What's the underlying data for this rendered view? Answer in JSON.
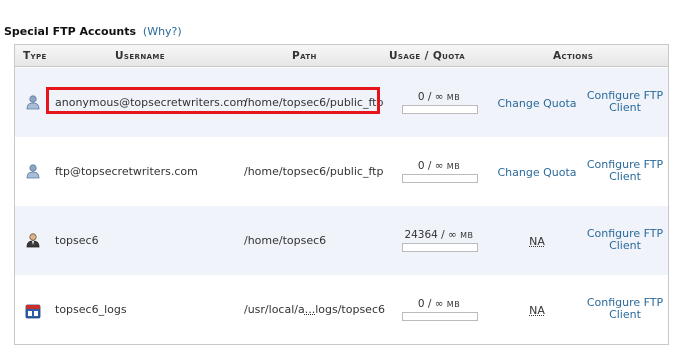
{
  "section": {
    "title": "Special FTP Accounts",
    "why": "(Why?)"
  },
  "columns": {
    "type": "Type",
    "username": "Username",
    "path": "Path",
    "quota": "Usage / Quota",
    "actions": "Actions"
  },
  "rows": [
    {
      "icon": "user-icon",
      "username": "anonymous@topsecretwriters.com",
      "path": "/home/topsec6/public_ftp",
      "usage": "0 / ∞",
      "unit": "MB",
      "usage_fraction": 0,
      "action1": "Change Quota",
      "action2_line1": "Configure FTP",
      "action2_line2": "Client",
      "highlighted": true
    },
    {
      "icon": "user-icon",
      "username": "ftp@topsecretwriters.com",
      "path": "/home/topsec6/public_ftp",
      "usage": "0 / ∞",
      "unit": "MB",
      "usage_fraction": 0,
      "action1": "Change Quota",
      "action2_line1": "Configure FTP",
      "action2_line2": "Client"
    },
    {
      "icon": "admin-user-icon",
      "username": "topsec6",
      "path": "/home/topsec6",
      "usage": "24364 / ∞",
      "unit": "MB",
      "usage_fraction": 0,
      "action1": "NA",
      "action2_line1": "Configure FTP",
      "action2_line2": "Client"
    },
    {
      "icon": "logs-icon",
      "username": "topsec6_logs",
      "path_prefix": "/usr/local/a",
      "path_ellipsis": "...",
      "path_suffix": "logs/topsec6",
      "usage": "0 / ∞",
      "unit": "MB",
      "usage_fraction": 0,
      "action1": "NA",
      "action2_line1": "Configure FTP",
      "action2_line2": "Client"
    }
  ],
  "colors": {
    "link": "#2a6a9a",
    "highlight": "#e8141c",
    "row_alt": "#f0f3fa"
  }
}
